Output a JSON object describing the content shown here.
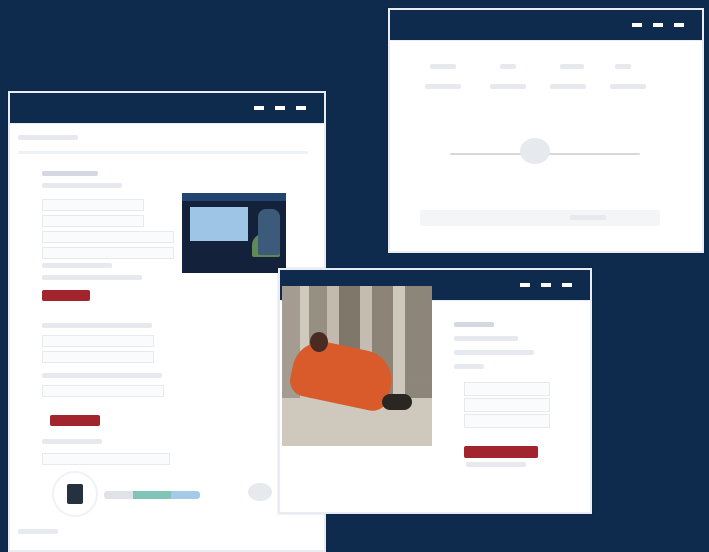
{
  "palette": {
    "background": "#0e2a4d",
    "title_bar": "#0e2a4d",
    "accent_red": "#a2252d",
    "placeholder_line": "#e6e9ee"
  },
  "windows": [
    {
      "id": "win-back-right",
      "title_bar_controls": [
        "dot",
        "dot",
        "dot"
      ],
      "content": {
        "top_icons": [
          "icon-1",
          "icon-2",
          "icon-3",
          "icon-4"
        ],
        "center_icon": "settings-icon"
      }
    },
    {
      "id": "win-left",
      "title_bar_controls": [
        "dot",
        "dot",
        "dot"
      ],
      "content": {
        "media_thumbnail": "video-thumbnail",
        "primary_buttons": 2,
        "footer_icon": "device-icon"
      }
    },
    {
      "id": "win-front",
      "title_bar_controls": [
        "dot",
        "dot",
        "dot"
      ],
      "content": {
        "hero_image": "photo-woman-with-dog",
        "primary_buttons": 1
      }
    }
  ]
}
